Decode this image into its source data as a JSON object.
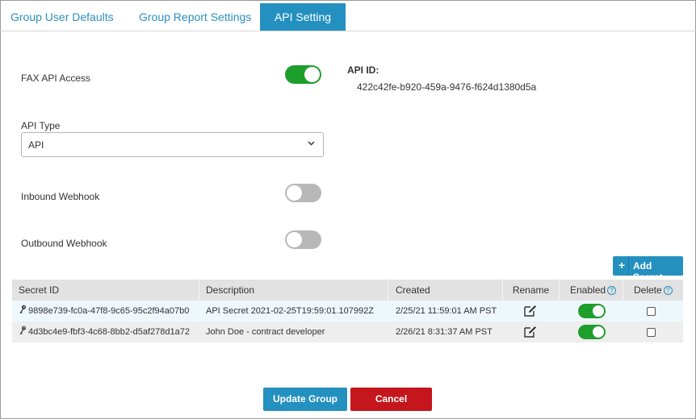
{
  "tabs": [
    {
      "label": "Group User Defaults"
    },
    {
      "label": "Group Report Settings"
    },
    {
      "label": "API Setting"
    }
  ],
  "fax_api_access": {
    "label": "FAX API Access",
    "enabled": true
  },
  "api_id": {
    "label": "API ID:",
    "value": "422c42fe-b920-459a-9476-f624d1380d5a"
  },
  "api_type": {
    "label": "API Type",
    "value": "API"
  },
  "inbound_webhook": {
    "label": "Inbound Webhook",
    "enabled": false
  },
  "outbound_webhook": {
    "label": "Outbound Webhook",
    "enabled": false
  },
  "add_secret": {
    "plus": "+",
    "label": "Add Secret"
  },
  "secrets_table": {
    "columns": [
      "Secret ID",
      "Description",
      "Created",
      "Rename",
      "Enabled",
      "Delete"
    ],
    "rows": [
      {
        "secret_id": "9898e739-fc0a-47f8-9c65-95c2f94a07b0",
        "description": "API Secret 2021-02-25T19:59:01.107992Z",
        "created": "2/25/21 11:59:01 AM PST",
        "enabled": true,
        "delete": false
      },
      {
        "secret_id": "4d3bc4e9-fbf3-4c68-8bb2-d5af278d1a72",
        "description": "John Doe - contract developer",
        "created": "2/26/21 8:31:37 AM PST",
        "enabled": true,
        "delete": false
      }
    ]
  },
  "buttons": {
    "update": "Update Group",
    "cancel": "Cancel"
  },
  "colors": {
    "accent": "#2490c0",
    "toggle_on": "#1e9e2d",
    "toggle_off": "#b8b8b8",
    "danger": "#c4161c"
  },
  "icons": {
    "key": "key-icon",
    "edit": "edit-icon",
    "info": "info-icon",
    "chevron": "chevron-down-icon"
  }
}
